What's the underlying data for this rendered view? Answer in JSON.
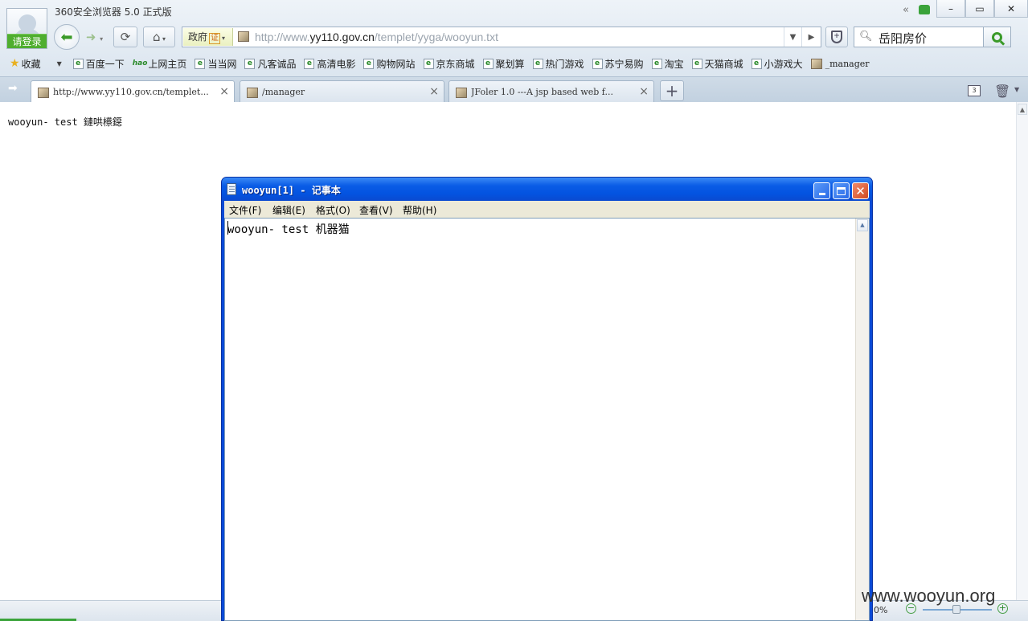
{
  "browser": {
    "title": "360安全浏览器 5.0 正式版",
    "login_label": "请登录",
    "controls": {
      "minimize": "–",
      "restore": "▭",
      "close": "✕"
    },
    "address": {
      "gov_label": "政府",
      "cert_label": "证",
      "url_prefix": "http://www.",
      "url_domain": "yy110.gov.cn",
      "url_path": "/templet/yyga/wooyun.txt"
    },
    "search": {
      "value": "岳阳房价"
    },
    "favorites_label": "收藏",
    "favorites": [
      {
        "label": "百度一下",
        "icon": "ie-icon"
      },
      {
        "label": "上网主页",
        "icon": "hao-icon"
      },
      {
        "label": "当当网",
        "icon": "ie-icon"
      },
      {
        "label": "凡客诚品",
        "icon": "ie-icon"
      },
      {
        "label": "高清电影",
        "icon": "ie-icon"
      },
      {
        "label": "购物网站",
        "icon": "ie-icon"
      },
      {
        "label": "京东商城",
        "icon": "ie-icon"
      },
      {
        "label": "聚划算",
        "icon": "ie-icon"
      },
      {
        "label": "热门游戏",
        "icon": "ie-icon"
      },
      {
        "label": "苏宁易购",
        "icon": "ie-icon"
      },
      {
        "label": "淘宝",
        "icon": "ie-icon"
      },
      {
        "label": "天猫商城",
        "icon": "ie-icon"
      },
      {
        "label": "小游戏大",
        "icon": "ie-icon"
      },
      {
        "label": "_manager",
        "icon": "image-icon"
      }
    ],
    "tabs": [
      {
        "title": "http://www.yy110.gov.cn/templet...",
        "active": true
      },
      {
        "title": "/manager",
        "active": false
      },
      {
        "title": "JFoler 1.0 ---A jsp based web f...",
        "active": false
      }
    ],
    "closed_tab_count": "3",
    "zoom": "0%"
  },
  "page": {
    "text": "wooyun- test 鏈哄櫒鐚"
  },
  "notepad": {
    "title": "wooyun[1] - 记事本",
    "menu": [
      "文件(F)",
      "编辑(E)",
      "格式(O)",
      "查看(V)",
      "帮助(H)"
    ],
    "content": "wooyun- test 机器猫"
  },
  "watermark": "www.wooyun.org"
}
